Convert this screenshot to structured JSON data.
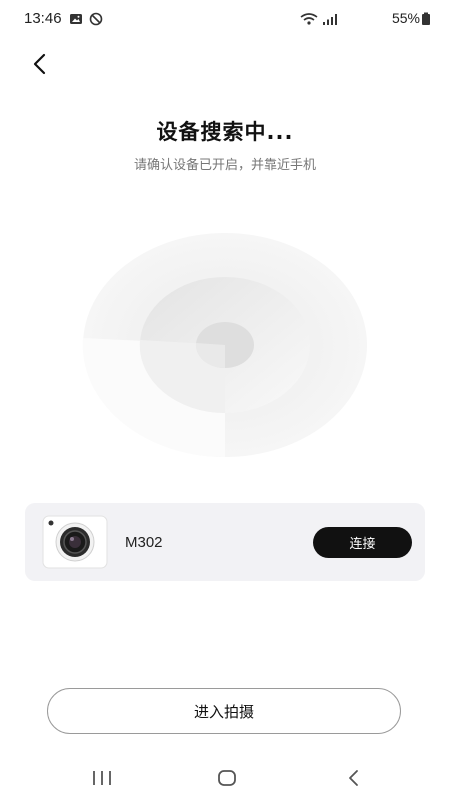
{
  "status_bar": {
    "time": "13:46",
    "battery": "55%"
  },
  "header": {
    "title": "设备搜索中...",
    "subtitle": "请确认设备已开启，并靠近手机"
  },
  "device": {
    "name": "M302",
    "connect_label": "连接"
  },
  "footer": {
    "enter_label": "进入拍摄"
  },
  "colors": {
    "card_bg": "#f2f2f5",
    "button_dark": "#111111",
    "subtitle_gray": "#777777"
  }
}
